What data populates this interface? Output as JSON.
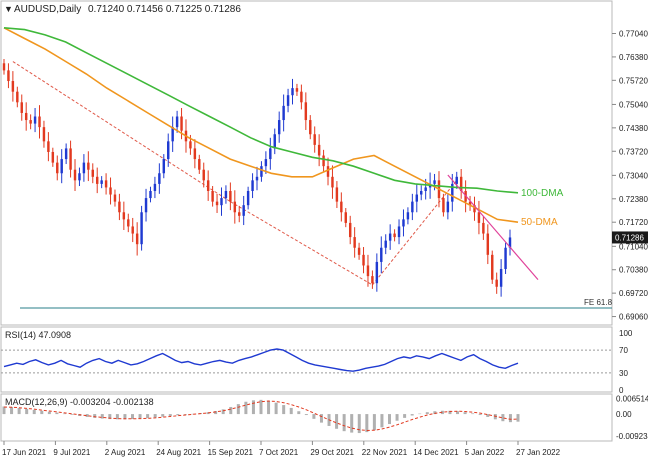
{
  "header": {
    "symbol": "AUDUSD,Daily",
    "ohlc": "0.71240 0.71456 0.71225 0.71286"
  },
  "colors": {
    "bull": "#1f3ad1",
    "bear": "#e2391f",
    "dma50": "#f0961e",
    "dma100": "#3fb83a",
    "trend": "#e05a4a",
    "resist": "#e0429a",
    "fe": "#2a7f8a",
    "rsi": "#1f3ad1",
    "macd_hist": "#b0b0b0",
    "macd_signal": "#e2391f"
  },
  "chart_data": [
    {
      "type": "candlestick",
      "ylim": [
        0.6885,
        0.779
      ],
      "yticks": [
        "0.77040",
        "0.76380",
        "0.75720",
        "0.75040",
        "0.74380",
        "0.73720",
        "0.73040",
        "0.72380",
        "0.71720",
        "0.71040",
        "0.70380",
        "0.69720",
        "0.69060"
      ],
      "xticks": [
        "17 Jun 2021",
        "9 Jul 2021",
        "2 Aug 2021",
        "24 Aug 2021",
        "15 Sep 2021",
        "7 Oct 2021",
        "29 Oct 2021",
        "22 Nov 2021",
        "14 Dec 2021",
        "5 Jan 2022",
        "27 Jan 2022"
      ],
      "last_price": "0.71286",
      "close_path": [
        0.76,
        0.757,
        0.754,
        0.751,
        0.748,
        0.746,
        0.745,
        0.747,
        0.744,
        0.74,
        0.737,
        0.734,
        0.731,
        0.735,
        0.738,
        0.732,
        0.729,
        0.731,
        0.734,
        0.732,
        0.73,
        0.728,
        0.729,
        0.727,
        0.725,
        0.723,
        0.72,
        0.718,
        0.716,
        0.714,
        0.711,
        0.72,
        0.724,
        0.726,
        0.728,
        0.731,
        0.735,
        0.74,
        0.744,
        0.747,
        0.743,
        0.74,
        0.738,
        0.735,
        0.732,
        0.729,
        0.726,
        0.723,
        0.722,
        0.724,
        0.726,
        0.723,
        0.72,
        0.719,
        0.722,
        0.726,
        0.729,
        0.73,
        0.733,
        0.735,
        0.738,
        0.742,
        0.746,
        0.75,
        0.753,
        0.755,
        0.754,
        0.751,
        0.746,
        0.742,
        0.739,
        0.736,
        0.733,
        0.73,
        0.727,
        0.723,
        0.72,
        0.717,
        0.713,
        0.71,
        0.708,
        0.705,
        0.702,
        0.7,
        0.706,
        0.71,
        0.712,
        0.714,
        0.713,
        0.716,
        0.718,
        0.72,
        0.723,
        0.725,
        0.726,
        0.727,
        0.728,
        0.729,
        0.724,
        0.72,
        0.723,
        0.728,
        0.73,
        0.726,
        0.723,
        0.722,
        0.72,
        0.717,
        0.714,
        0.708,
        0.701,
        0.699,
        0.704,
        0.71,
        0.7129
      ],
      "annotations": [
        {
          "label": "100-DMA",
          "value": 0.7255
        },
        {
          "label": "50-DMA",
          "value": 0.7172
        },
        {
          "label": "FE 61.8",
          "value": 0.693
        }
      ],
      "dma50": [
        0.772,
        0.769,
        0.766,
        0.7625,
        0.759,
        0.755,
        0.7515,
        0.748,
        0.7445,
        0.741,
        0.738,
        0.735,
        0.733,
        0.731,
        0.73,
        0.73,
        0.7325,
        0.735,
        0.736,
        0.733,
        0.73,
        0.727,
        0.724,
        0.721,
        0.718,
        0.7172
      ],
      "dma100": [
        0.772,
        0.7715,
        0.77,
        0.768,
        0.765,
        0.762,
        0.759,
        0.756,
        0.753,
        0.75,
        0.747,
        0.744,
        0.741,
        0.7385,
        0.737,
        0.7355,
        0.7345,
        0.733,
        0.731,
        0.729,
        0.728,
        0.7275,
        0.727,
        0.7268,
        0.726,
        0.7255
      ]
    },
    {
      "type": "line",
      "title": "RSI(14) 47.0908",
      "ylim": [
        0,
        100
      ],
      "yticks": [
        "100",
        "70",
        "30",
        "0"
      ],
      "values": [
        41,
        44,
        47,
        45,
        50,
        53,
        48,
        44,
        47,
        52,
        46,
        43,
        40,
        47,
        52,
        55,
        50,
        47,
        52,
        48,
        44,
        46,
        50,
        55,
        60,
        64,
        58,
        52,
        48,
        50,
        46,
        44,
        47,
        50,
        52,
        49,
        47,
        52,
        55,
        58,
        62,
        66,
        70,
        72,
        70,
        64,
        58,
        52,
        47,
        44,
        42,
        40,
        38,
        36,
        34,
        33,
        35,
        38,
        40,
        42,
        45,
        50,
        55,
        58,
        56,
        60,
        58,
        55,
        60,
        64,
        60,
        56,
        52,
        58,
        62,
        55,
        50,
        44,
        40,
        38,
        43,
        47
      ]
    },
    {
      "type": "bar",
      "title": "MACD(12,26,9) -0.003204 -0.002138",
      "ylim": [
        -0.0105,
        0.0072
      ],
      "yticks": [
        "0.006514",
        "0.00",
        "-0.009234"
      ],
      "histogram": [
        0.0032,
        0.003,
        0.0026,
        0.0022,
        0.0018,
        0.0014,
        0.001,
        0.0006,
        0.0002,
        -0.0003,
        -0.0008,
        -0.0012,
        -0.0016,
        -0.0019,
        -0.0021,
        -0.0022,
        -0.0022,
        -0.0021,
        -0.0019,
        -0.0017,
        -0.0014,
        -0.0011,
        -0.0008,
        -0.0005,
        -0.0002,
        0.0001,
        0.0004,
        0.0008,
        0.0013,
        0.002,
        0.003,
        0.0042,
        0.0052,
        0.0058,
        0.006,
        0.0056,
        0.0048,
        0.0038,
        0.0026,
        0.0012,
        -0.0004,
        -0.002,
        -0.0036,
        -0.005,
        -0.0062,
        -0.0072,
        -0.0078,
        -0.008,
        -0.0076,
        -0.0068,
        -0.0056,
        -0.0042,
        -0.0028,
        -0.0016,
        -0.0006,
        0.0002,
        0.0008,
        0.0012,
        0.0014,
        0.0014,
        0.0012,
        0.0008,
        0.0003,
        -0.0004,
        -0.0012,
        -0.0022,
        -0.003,
        -0.0034,
        -0.0032
      ],
      "signal": [
        0.003,
        0.0029,
        0.0027,
        0.0024,
        0.0021,
        0.0017,
        0.0013,
        0.0009,
        0.0005,
        0.0001,
        -0.0003,
        -0.0007,
        -0.0011,
        -0.0014,
        -0.0017,
        -0.0019,
        -0.002,
        -0.002,
        -0.0019,
        -0.0018,
        -0.0016,
        -0.0013,
        -0.001,
        -0.0007,
        -0.0004,
        -0.0001,
        0.0002,
        0.0005,
        0.0009,
        0.0014,
        0.0021,
        0.0029,
        0.0038,
        0.0046,
        0.0052,
        0.0055,
        0.0053,
        0.0048,
        0.004,
        0.003,
        0.0018,
        0.0004,
        -0.001,
        -0.0024,
        -0.0037,
        -0.0049,
        -0.0059,
        -0.0066,
        -0.0069,
        -0.0068,
        -0.0063,
        -0.0055,
        -0.0045,
        -0.0034,
        -0.0023,
        -0.0013,
        -0.0004,
        0.0003,
        0.0008,
        0.0011,
        0.0012,
        0.0011,
        0.0008,
        0.0004,
        -0.0002,
        -0.0009,
        -0.0016,
        -0.0022,
        -0.0021
      ]
    }
  ]
}
